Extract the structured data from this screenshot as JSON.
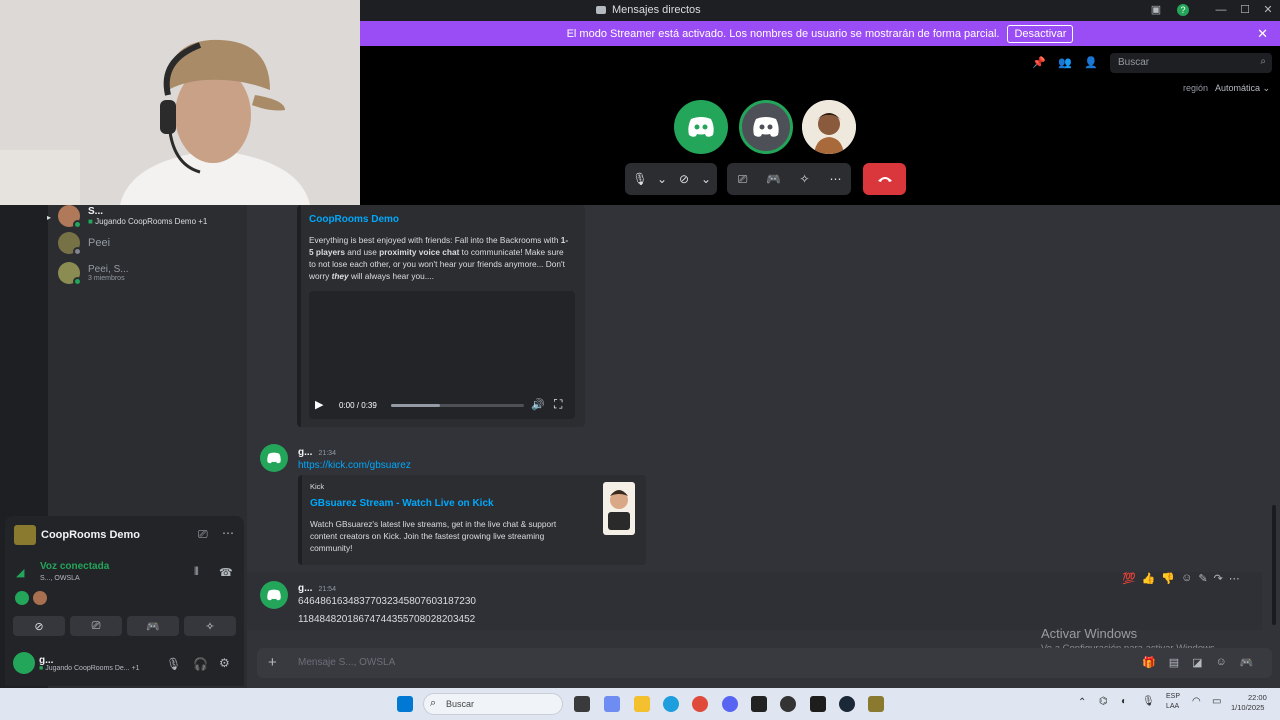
{
  "window": {
    "title": "Mensajes directos"
  },
  "banner": {
    "text": "El modo Streamer está activado. Los nombres de usuario se mostrarán de forma parcial.",
    "button": "Desactivar"
  },
  "call": {
    "search_placeholder": "Buscar",
    "region_label": "región",
    "region_value": "Automática",
    "colors": {
      "green": "#23a55a",
      "red": "#da373c"
    }
  },
  "sidebar": {
    "dms": [
      {
        "name": "S...",
        "status": "Jugando CoopRooms Demo +1"
      },
      {
        "name": "Peei"
      },
      {
        "name": "Peei, S...",
        "status": "3 miembros"
      }
    ]
  },
  "voice": {
    "activity_title": "CoopRooms Demo",
    "connected_label": "Voz conectada",
    "channel": "S..., OWSLA"
  },
  "user": {
    "name": "g...",
    "status": "Jugando CoopRooms De... +1"
  },
  "chat": {
    "embed1": {
      "title": "CoopRooms Demo",
      "desc_parts": [
        "Everything is best enjoyed with friends: Fall into the Backrooms with ",
        "1-5 players",
        " and use ",
        "proximity voice chat",
        " to communicate! Make sure to not lose each other, or you won't hear your friends anymore... Don't worry ",
        "they",
        " will always hear you...."
      ],
      "video_time": "0:00 / 0:39",
      "video_progress": 0.37
    },
    "msg2": {
      "author": "g...",
      "time": "21:34",
      "link": "https://kick.com/gbsuarez",
      "embed_provider": "Kick",
      "embed_title": "GBsuarez Stream - Watch Live on Kick",
      "embed_desc": "Watch GBsuarez's latest live streams, get in the live chat & support content creators on Kick. Join the fastest growing live streaming community!"
    },
    "msg3": {
      "author": "g...",
      "time": "21:54",
      "line1": "64648616348377032345807603187230",
      "line2": "11848482018674744355708028203452"
    },
    "composer_placeholder": "Mensaje S..., OWSLA"
  },
  "watermark": {
    "line1": "Activar Windows",
    "line2": "Ve a Configuración para activar Windows."
  },
  "taskbar": {
    "search": "Buscar",
    "lang1": "ESP",
    "lang2": "LAA",
    "time": "22:00",
    "date": "1/10/2025"
  }
}
